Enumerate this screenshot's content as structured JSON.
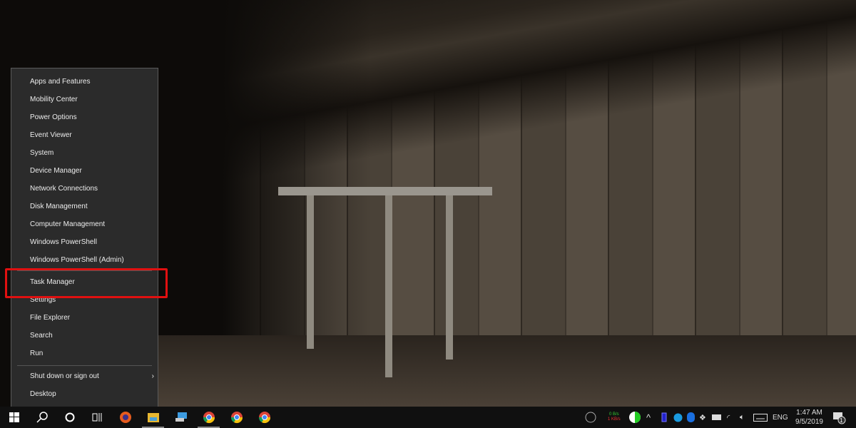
{
  "menu": {
    "items": [
      "Apps and Features",
      "Mobility Center",
      "Power Options",
      "Event Viewer",
      "System",
      "Device Manager",
      "Network Connections",
      "Disk Management",
      "Computer Management",
      "Windows PowerShell",
      "Windows PowerShell (Admin)"
    ],
    "items2": [
      "Task Manager",
      "Settings",
      "File Explorer",
      "Search",
      "Run"
    ],
    "shutdown": "Shut down or sign out",
    "desktop": "Desktop",
    "highlighted": "Task Manager"
  },
  "taskbar": {
    "apps": [
      "start-icon",
      "search-icon",
      "cortana-icon",
      "task-view-icon",
      "firefox-icon",
      "file-explorer-icon",
      "network-app-icon",
      "chrome-icon",
      "chrome-icon",
      "chrome-icon"
    ]
  },
  "tray": {
    "net_up": "0 B/s",
    "net_down": "1 KB/s",
    "language": "ENG",
    "time": "1:47 AM",
    "date": "9/5/2019",
    "notifications": "1"
  },
  "colors": {
    "highlight": "#e01010",
    "menu_bg": "#2b2b2b",
    "taskbar": "#101010"
  }
}
